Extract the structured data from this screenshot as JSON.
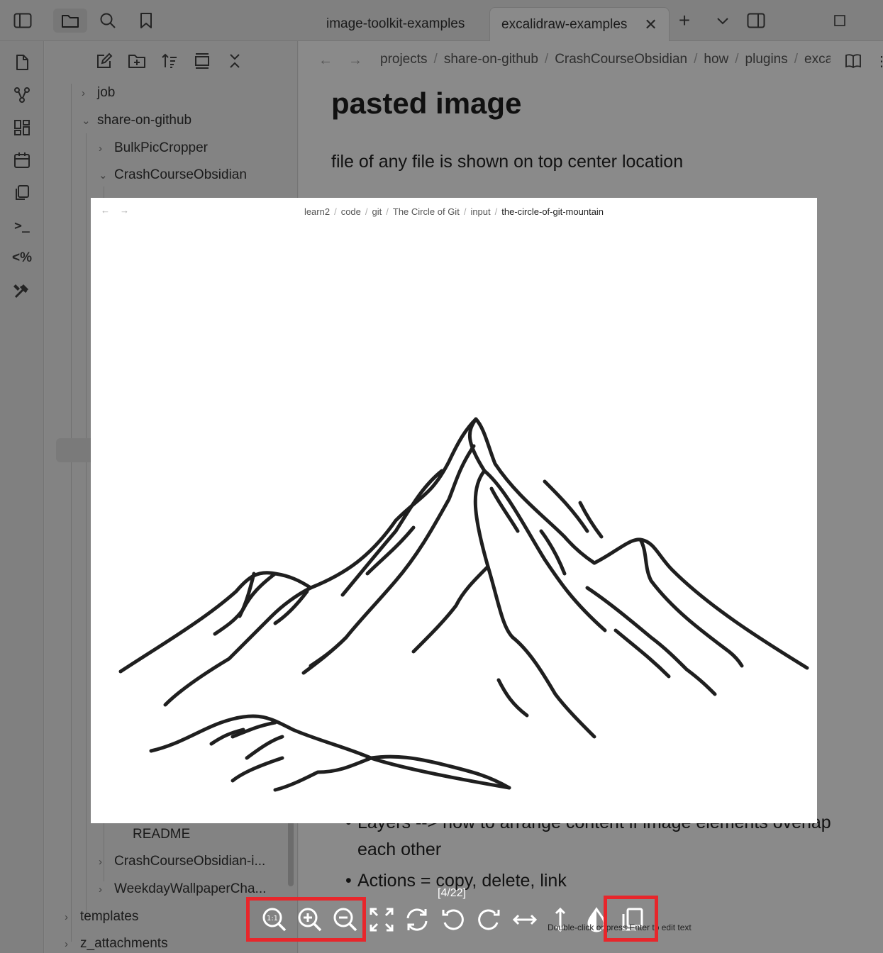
{
  "titlebar": {
    "tabs": [
      {
        "label": "image-toolkit-examples",
        "active": false
      },
      {
        "label": "excalidraw-examples",
        "active": true
      }
    ],
    "close_glyph": "✕",
    "new_tab_glyph": "+",
    "more_glyph": "⌄"
  },
  "ribbon": {
    "items": [
      "file-icon",
      "graph-icon",
      "canvas-icon",
      "calendar-icon",
      "copy-icon",
      "terminal-icon",
      "templater-icon",
      "tools-icon"
    ],
    "terminal_glyph": ">_",
    "templater_glyph": "<%"
  },
  "explorer": {
    "items": [
      {
        "label": "job",
        "chevron": "›"
      },
      {
        "label": "share-on-github",
        "chevron": "⌄"
      },
      {
        "label": "BulkPicCropper",
        "chevron": "›"
      },
      {
        "label": "CrashCourseObsidian",
        "chevron": "⌄"
      },
      {
        "label": "README",
        "chevron": ""
      },
      {
        "label": "CrashCourseObsidian-i...",
        "chevron": "›"
      },
      {
        "label": "WeekdayWallpaperCha...",
        "chevron": "›"
      },
      {
        "label": "templates",
        "chevron": "›"
      },
      {
        "label": "z_attachments",
        "chevron": "›"
      }
    ]
  },
  "editor": {
    "breadcrumbs": [
      "projects",
      "share-on-github",
      "CrashCourseObsidian",
      "how",
      "plugins",
      "excalidraw"
    ],
    "title": "pasted image",
    "line1": "file of any file is shown on top center location",
    "bullets": [
      "Layers --> how to arrange content if image elements overlap",
      "each other",
      "Actions = copy, delete, link"
    ]
  },
  "viewer": {
    "breadcrumbs": [
      "learn2",
      "code",
      "git",
      "The Circle of Git",
      "input",
      "the-circle-of-git-mountain"
    ],
    "counter": "[4/22]",
    "hint": "Double-click or press Enter to edit text",
    "toolbar": [
      "zoom-reset-icon",
      "zoom-in-icon",
      "zoom-out-icon",
      "fullscreen-icon",
      "refresh-icon",
      "rotate-left-icon",
      "rotate-right-icon",
      "flip-horizontal-icon",
      "flip-vertical-icon",
      "invert-color-icon",
      "copy-image-icon"
    ],
    "reset_glyph": "1:1"
  },
  "colors": {
    "highlight": "#e8262b",
    "overlay": "rgba(0,0,0,0.46)"
  }
}
